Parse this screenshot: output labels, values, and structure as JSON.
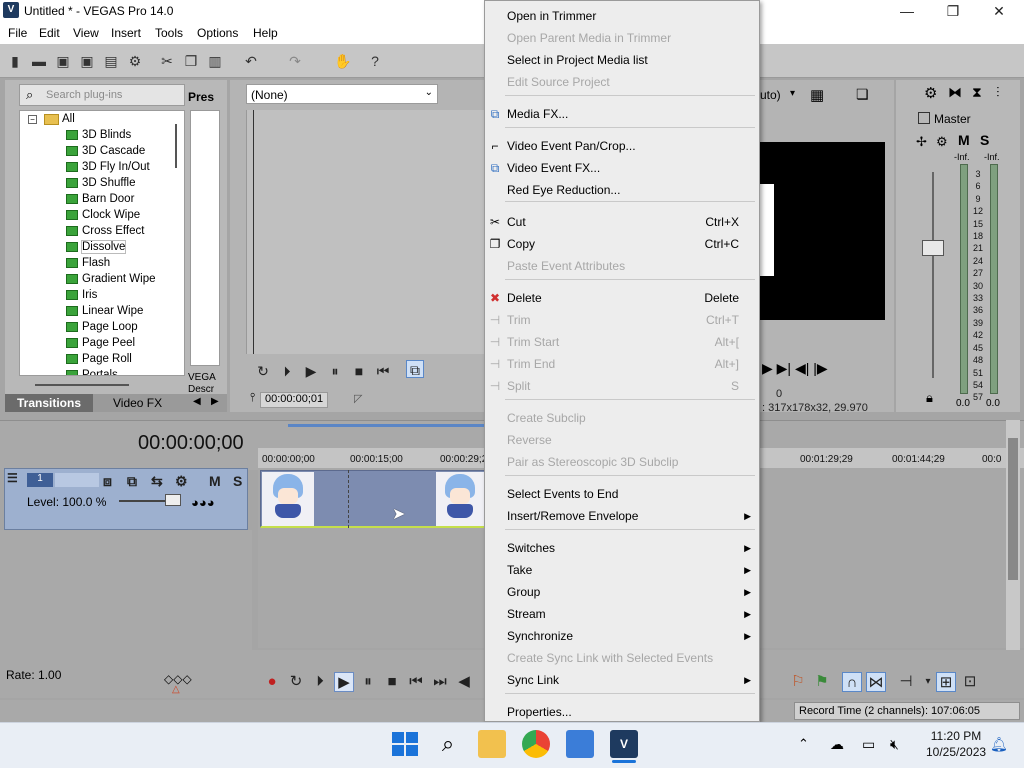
{
  "window": {
    "title": "Untitled * - VEGAS Pro 14.0",
    "minimize": "—",
    "maximize": "❐",
    "close": "✕"
  },
  "menubar": [
    "File",
    "Edit",
    "View",
    "Insert",
    "Tools",
    "Options",
    "Help"
  ],
  "plugins": {
    "search_placeholder": "Search plug-ins",
    "presets_title": "Pres",
    "root": "All",
    "items": [
      "3D Blinds",
      "3D Cascade",
      "3D Fly In/Out",
      "3D Shuffle",
      "Barn Door",
      "Clock Wipe",
      "Cross Effect",
      "Dissolve",
      "Flash",
      "Gradient Wipe",
      "Iris",
      "Linear Wipe",
      "Page Loop",
      "Page Peel",
      "Page Roll",
      "Portals"
    ],
    "selected": "Dissolve",
    "desc_lines": [
      "VEGA",
      "Descr"
    ],
    "tabs": [
      "Transitions",
      "Video FX"
    ]
  },
  "trimmer": {
    "select_value": "(None)",
    "timecode": "00:00:00;01"
  },
  "preview": {
    "partial_label": "uto)",
    "value": "0",
    "frame_info": "317x178x32, 29.970"
  },
  "master": {
    "title": "Master",
    "m": "M",
    "s": "S",
    "inf_left": "-Inf.",
    "inf_right": "-Inf.",
    "scale": [
      "3",
      "6",
      "9",
      "12",
      "15",
      "18",
      "21",
      "24",
      "27",
      "30",
      "33",
      "36",
      "39",
      "42",
      "45",
      "48",
      "51",
      "54",
      "57"
    ],
    "db_left": "0.0",
    "db_right": "0.0"
  },
  "timeline": {
    "timecode": "00:00:00;00",
    "ruler": [
      "00:00:00;00",
      "00:00:15;00",
      "00:00:29;2",
      "00:01:29;29",
      "00:01:44;29",
      "00:0"
    ],
    "track_number": "1",
    "m": "M",
    "s": "S",
    "level": "Level: 100.0 %"
  },
  "transport": {
    "rate": "Rate: 1.00",
    "record_time": "Record Time (2 channels): 107:06:05"
  },
  "taskbar": {
    "time": "11:20 PM",
    "date": "10/25/2023"
  },
  "context_menu": {
    "items": [
      {
        "label": "Open in Trimmer",
        "enabled": true
      },
      {
        "label": "Open Parent Media in Trimmer",
        "enabled": false
      },
      {
        "label": "Select in Project Media list",
        "enabled": true
      },
      {
        "label": "Edit Source Project",
        "enabled": false
      },
      {
        "label": "Media FX...",
        "enabled": true
      },
      {
        "label": "Video Event Pan/Crop...",
        "enabled": true
      },
      {
        "label": "Video Event FX...",
        "enabled": true
      },
      {
        "label": "Red Eye Reduction...",
        "enabled": true
      },
      {
        "label": "Cut",
        "shortcut": "Ctrl+X",
        "enabled": true
      },
      {
        "label": "Copy",
        "shortcut": "Ctrl+C",
        "enabled": true
      },
      {
        "label": "Paste Event Attributes",
        "enabled": false
      },
      {
        "label": "Delete",
        "shortcut": "Delete",
        "enabled": true
      },
      {
        "label": "Trim",
        "shortcut": "Ctrl+T",
        "enabled": false
      },
      {
        "label": "Trim Start",
        "shortcut": "Alt+[",
        "enabled": false
      },
      {
        "label": "Trim End",
        "shortcut": "Alt+]",
        "enabled": false
      },
      {
        "label": "Split",
        "shortcut": "S",
        "enabled": false
      },
      {
        "label": "Create Subclip",
        "enabled": false
      },
      {
        "label": "Reverse",
        "enabled": false
      },
      {
        "label": "Pair as Stereoscopic 3D Subclip",
        "enabled": false
      },
      {
        "label": "Select Events to End",
        "enabled": true
      },
      {
        "label": "Insert/Remove Envelope",
        "enabled": true,
        "submenu": true
      },
      {
        "label": "Switches",
        "enabled": true,
        "submenu": true
      },
      {
        "label": "Take",
        "enabled": true,
        "submenu": true
      },
      {
        "label": "Group",
        "enabled": true,
        "submenu": true
      },
      {
        "label": "Stream",
        "enabled": true,
        "submenu": true
      },
      {
        "label": "Synchronize",
        "enabled": true,
        "submenu": true
      },
      {
        "label": "Create Sync Link with Selected Events",
        "enabled": false
      },
      {
        "label": "Sync Link",
        "enabled": true,
        "submenu": true
      },
      {
        "label": "Properties...",
        "enabled": true
      }
    ]
  },
  "colors": {
    "clip_bg": "#7d8cb0",
    "track_header": "#9db0cf",
    "menu_bg": "#ededed",
    "disabled_text": "#a7a7a7"
  }
}
